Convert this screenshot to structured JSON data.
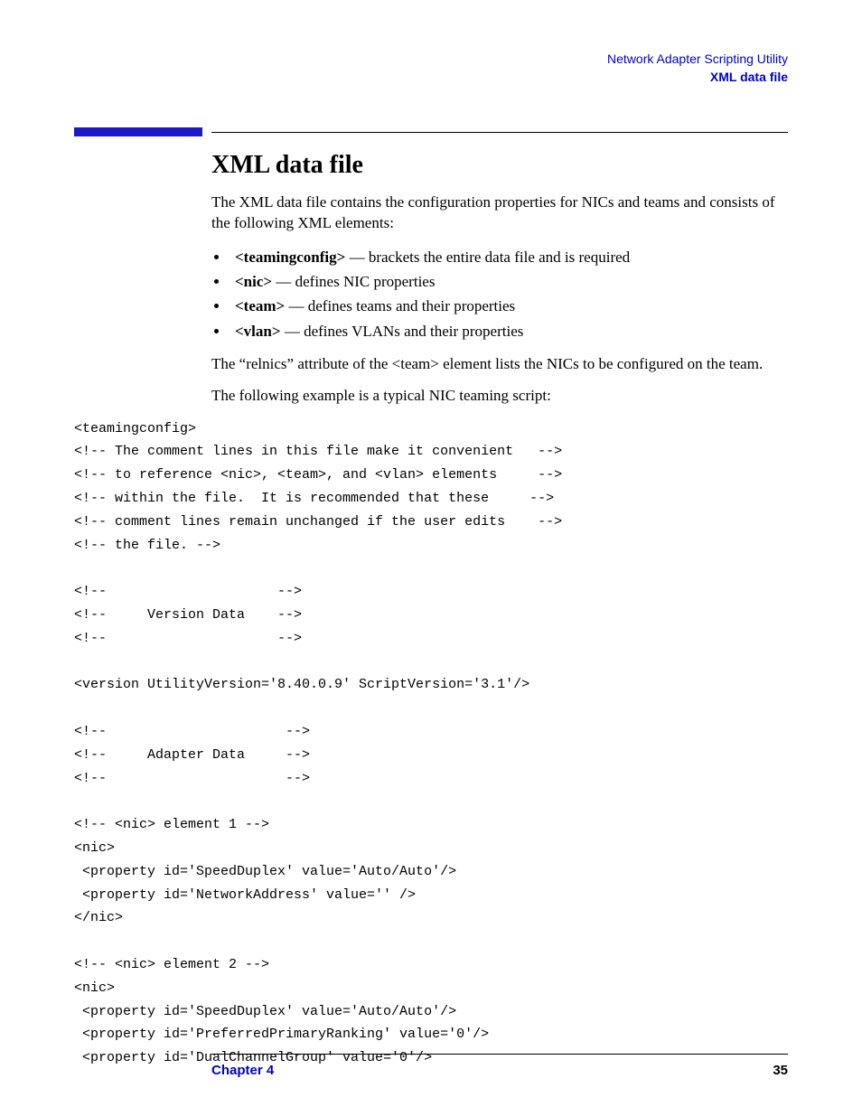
{
  "header": {
    "line1": "Network Adapter Scripting Utility",
    "line2": "XML data file"
  },
  "title": "XML data file",
  "intro": "The XML data file contains the configuration properties for NICs and teams and consists of the following XML elements:",
  "bullets": [
    {
      "tag": "<teamingconfig>",
      "desc": " — brackets the entire data file and is required"
    },
    {
      "tag": "<nic>",
      "desc": " — defines NIC properties"
    },
    {
      "tag": "<team>",
      "desc": " — defines teams and their properties"
    },
    {
      "tag": "<vlan>",
      "desc": " — defines VLANs and their properties"
    }
  ],
  "para2": "The “relnics” attribute of the <team> element lists the NICs to be configured on the team.",
  "para3": "The following example is a typical NIC teaming script:",
  "code": "<teamingconfig>\n<!-- The comment lines in this file make it convenient   -->\n<!-- to reference <nic>, <team>, and <vlan> elements     -->\n<!-- within the file.  It is recommended that these     -->\n<!-- comment lines remain unchanged if the user edits    -->\n<!-- the file. -->\n\n<!--                     -->\n<!--     Version Data    -->\n<!--                     -->\n\n<version UtilityVersion='8.40.0.9' ScriptVersion='3.1'/>\n\n<!--                      -->\n<!--     Adapter Data     -->\n<!--                      -->\n\n<!-- <nic> element 1 -->\n<nic>\n <property id='SpeedDuplex' value='Auto/Auto'/>\n <property id='NetworkAddress' value='' />\n</nic>\n\n<!-- <nic> element 2 -->\n<nic>\n <property id='SpeedDuplex' value='Auto/Auto'/>\n <property id='PreferredPrimaryRanking' value='0'/>\n <property id='DualChannelGroup' value='0'/>",
  "footer": {
    "chapter": "Chapter 4",
    "page": "35"
  }
}
